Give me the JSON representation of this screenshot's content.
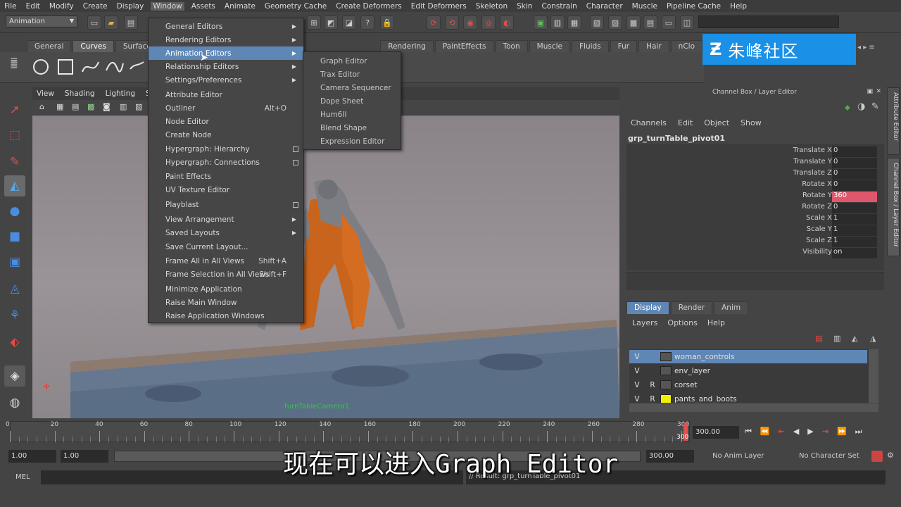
{
  "menubar": [
    "File",
    "Edit",
    "Modify",
    "Create",
    "Display",
    "Window",
    "Assets",
    "Animate",
    "Geometry Cache",
    "Create Deformers",
    "Edit Deformers",
    "Skeleton",
    "Skin",
    "Constrain",
    "Character",
    "Muscle",
    "Pipeline Cache",
    "Help"
  ],
  "mode_select": "Animation",
  "shelf_tabs": [
    "General",
    "Curves",
    "Surfaces",
    "Rendering",
    "PaintEffects",
    "Toon",
    "Muscle",
    "Fluids",
    "Fur",
    "Hair",
    "nClo"
  ],
  "viewport_menu": [
    "View",
    "Shading",
    "Lighting",
    "Sh"
  ],
  "camera_label": "turnTableCamera1",
  "window_menu": [
    {
      "label": "General Editors",
      "shortcut": "",
      "kind": "arrow"
    },
    {
      "label": "Rendering Editors",
      "shortcut": "",
      "kind": "arrow"
    },
    {
      "label": "Animation Editors",
      "shortcut": "",
      "kind": "arrow"
    },
    {
      "label": "Relationship Editors",
      "shortcut": "",
      "kind": "arrow"
    },
    {
      "label": "Settings/Preferences",
      "shortcut": "",
      "kind": "arrow"
    },
    {
      "label": "Attribute Editor",
      "shortcut": "",
      "kind": ""
    },
    {
      "label": "Outliner",
      "shortcut": "Alt+O",
      "kind": ""
    },
    {
      "label": "Node Editor",
      "shortcut": "",
      "kind": ""
    },
    {
      "label": "Create Node",
      "shortcut": "",
      "kind": ""
    },
    {
      "label": "Hypergraph: Hierarchy",
      "shortcut": "",
      "kind": "box"
    },
    {
      "label": "Hypergraph: Connections",
      "shortcut": "",
      "kind": "box"
    },
    {
      "label": "Paint Effects",
      "shortcut": "",
      "kind": ""
    },
    {
      "label": "UV Texture Editor",
      "shortcut": "",
      "kind": ""
    },
    {
      "label": "Playblast",
      "shortcut": "",
      "kind": "box"
    },
    {
      "label": "View Arrangement",
      "shortcut": "",
      "kind": "arrow"
    },
    {
      "label": "Saved Layouts",
      "shortcut": "",
      "kind": "arrow"
    },
    {
      "label": "Save Current Layout...",
      "shortcut": "",
      "kind": ""
    },
    {
      "label": "Frame All in All Views",
      "shortcut": "Shift+A",
      "kind": ""
    },
    {
      "label": "Frame Selection in All Views",
      "shortcut": "Shift+F",
      "kind": ""
    },
    {
      "label": "Minimize Application",
      "shortcut": "",
      "kind": ""
    },
    {
      "label": "Raise Main Window",
      "shortcut": "",
      "kind": ""
    },
    {
      "label": "Raise Application Windows",
      "shortcut": "",
      "kind": ""
    }
  ],
  "anim_editors_submenu": [
    "Graph Editor",
    "Trax Editor",
    "Camera Sequencer",
    "Dope Sheet",
    "Hum6II",
    "Blend Shape",
    "Expression Editor"
  ],
  "channel_box": {
    "title": "Channel Box / Layer Editor",
    "menu": [
      "Channels",
      "Edit",
      "Object",
      "Show"
    ],
    "object": "grp_turnTable_pivot01",
    "attrs": [
      {
        "name": "Translate X",
        "value": "0"
      },
      {
        "name": "Translate Y",
        "value": "0"
      },
      {
        "name": "Translate Z",
        "value": "0"
      },
      {
        "name": "Rotate X",
        "value": "0"
      },
      {
        "name": "Rotate Y",
        "value": "360"
      },
      {
        "name": "Rotate Z",
        "value": "0"
      },
      {
        "name": "Scale X",
        "value": "1"
      },
      {
        "name": "Scale Y",
        "value": "1"
      },
      {
        "name": "Scale Z",
        "value": "1"
      },
      {
        "name": "Visibility",
        "value": "on"
      }
    ],
    "side_tabs": [
      "Attribute Editor",
      "Channel Box / Layer Editor"
    ]
  },
  "layer_editor": {
    "tabs": [
      "Display",
      "Render",
      "Anim"
    ],
    "menu": [
      "Layers",
      "Options",
      "Help"
    ],
    "layers": [
      {
        "v": "V",
        "r": "",
        "name": "woman_controls",
        "color": "",
        "selected": true
      },
      {
        "v": "V",
        "r": "",
        "name": "env_layer",
        "color": "",
        "selected": false
      },
      {
        "v": "V",
        "r": "R",
        "name": "corset",
        "color": "",
        "selected": false
      },
      {
        "v": "V",
        "r": "R",
        "name": "pants_and_boots",
        "color": "#f0f000",
        "selected": false
      }
    ]
  },
  "timeline": {
    "ticks": [
      "0",
      "20",
      "40",
      "60",
      "80",
      "100",
      "120",
      "140",
      "160",
      "180",
      "200",
      "220",
      "240",
      "260",
      "280",
      "300"
    ],
    "current_frame": "300.00",
    "end_marker": "300"
  },
  "range": {
    "start": "1.00",
    "inner_start": "1.00",
    "inner_end": "300.00",
    "anim_layer": "No Anim Layer",
    "char_set": "No Character Set"
  },
  "cmd": {
    "label": "MEL",
    "result": "// Result: grp_turnTable_pivot01"
  },
  "subtitle": "现在可以进入Graph Editor",
  "watermark": "朱峰社区",
  "highlight_color": "#5f87b6",
  "selected_value_color": "#e0566b"
}
